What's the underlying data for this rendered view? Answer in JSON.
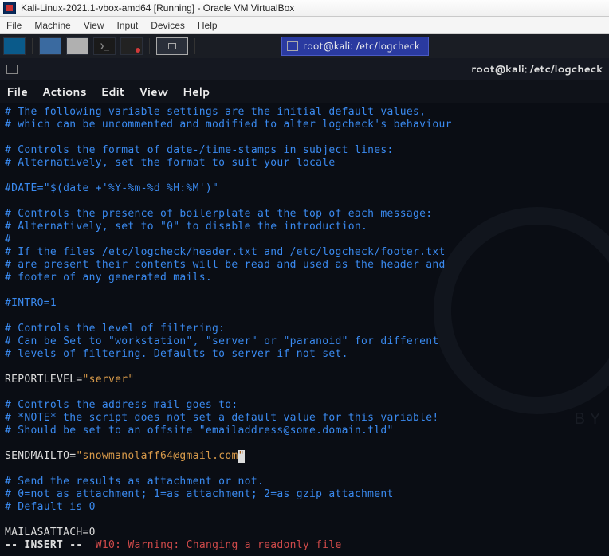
{
  "vbox": {
    "title": "Kali-Linux-2021.1-vbox-amd64 [Running] - Oracle VM VirtualBox",
    "menu": [
      "File",
      "Machine",
      "View",
      "Input",
      "Devices",
      "Help"
    ]
  },
  "kaliPanel": {
    "taskbarLabel": "root@kali: /etc/logcheck"
  },
  "terminal": {
    "windowTitle": "root@kali: /etc/logcheck",
    "menu": [
      "File",
      "Actions",
      "Edit",
      "View",
      "Help"
    ]
  },
  "editor": {
    "lines": [
      {
        "cls": "cm",
        "text": "# The following variable settings are the initial default values,"
      },
      {
        "cls": "cm",
        "text": "# which can be uncommented and modified to alter logcheck's behaviour"
      },
      {
        "cls": "",
        "text": ""
      },
      {
        "cls": "cm",
        "text": "# Controls the format of date-/time-stamps in subject lines:"
      },
      {
        "cls": "cm",
        "text": "# Alternatively, set the format to suit your locale"
      },
      {
        "cls": "",
        "text": ""
      },
      {
        "cls": "cm",
        "text": "#DATE=\"$(date +'%Y-%m-%d %H:%M')\""
      },
      {
        "cls": "",
        "text": ""
      },
      {
        "cls": "cm",
        "text": "# Controls the presence of boilerplate at the top of each message:"
      },
      {
        "cls": "cm",
        "text": "# Alternatively, set to \"0\" to disable the introduction."
      },
      {
        "cls": "cm",
        "text": "#"
      },
      {
        "cls": "cm",
        "text": "# If the files /etc/logcheck/header.txt and /etc/logcheck/footer.txt"
      },
      {
        "cls": "cm",
        "text": "# are present their contents will be read and used as the header and"
      },
      {
        "cls": "cm",
        "text": "# footer of any generated mails."
      },
      {
        "cls": "",
        "text": ""
      },
      {
        "cls": "cm",
        "text": "#INTRO=1"
      },
      {
        "cls": "",
        "text": ""
      },
      {
        "cls": "cm",
        "text": "# Controls the level of filtering:"
      },
      {
        "cls": "cm",
        "text": "# Can be Set to \"workstation\", \"server\" or \"paranoid\" for different"
      },
      {
        "cls": "cm",
        "text": "# levels of filtering. Defaults to server if not set."
      },
      {
        "cls": "",
        "text": ""
      }
    ],
    "reportLevelVar": "REPORTLEVEL=",
    "reportLevelVal": "\"server\"",
    "afterReportLines": [
      {
        "cls": "",
        "text": ""
      },
      {
        "cls": "cm",
        "text": "# Controls the address mail goes to:"
      },
      {
        "cls": "cm",
        "text": "# *NOTE* the script does not set a default value for this variable!"
      },
      {
        "cls": "cm",
        "text": "# Should be set to an offsite \"emailaddress@some.domain.tld\""
      },
      {
        "cls": "",
        "text": ""
      }
    ],
    "sendmailVar": "SENDMAILTO=",
    "sendmailVal": "\"snowmanolaff64@gmail.com",
    "sendmailCursor": "\"",
    "afterSendmailLines": [
      {
        "cls": "",
        "text": ""
      },
      {
        "cls": "cm",
        "text": "# Send the results as attachment or not."
      },
      {
        "cls": "cm",
        "text": "# 0=not as attachment; 1=as attachment; 2=as gzip attachment"
      },
      {
        "cls": "cm",
        "text": "# Default is 0"
      },
      {
        "cls": "",
        "text": ""
      }
    ],
    "mailasattach": "MAILASATTACH=0",
    "statusMode": "-- INSERT --",
    "statusWarn": "W10: Warning: Changing a readonly file"
  }
}
